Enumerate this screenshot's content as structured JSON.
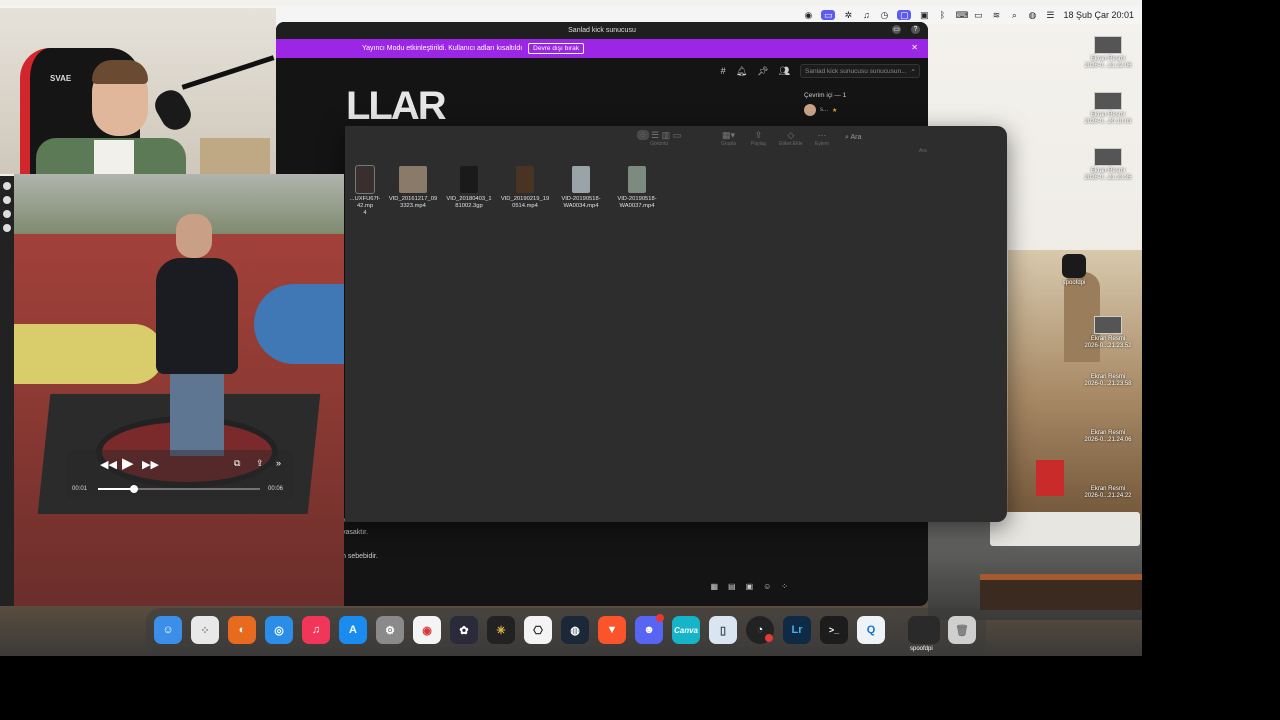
{
  "menubar": {
    "date_time": "18 Şub Çar  20:01"
  },
  "kick": {
    "window_title": "Sanlad kick sunucusu",
    "banner_text": "Yayıncı Modu etkinleştirildi. Kullanıcı adları kısaltıldı",
    "banner_button": "Devre dışı bırak",
    "search_placeholder": "Sanlad kick sunucusu sunucusun...",
    "banner_logo_text": "LLAR",
    "online_label": "Çevrim içi — 1",
    "online_user": "s...",
    "chat_lines": [
      "yasaktır.",
      "yasaktır.",
      "",
      "n sebebidir."
    ]
  },
  "finder": {
    "toolbar": {
      "view_label": "Görüntü",
      "group_label": "Grupla",
      "share_label": "Paylaş",
      "tag_label": "Etiket Ekle",
      "action_label": "Eylem",
      "search_placeholder": "Ara",
      "search_label": "Ara"
    },
    "files": [
      {
        "name": "...UXFU67f-42.mp4",
        "display": "...UXFU67f-42.mp\n4"
      },
      {
        "name": "VID_20161217_093323.mp4",
        "display": "VID_20161217_09\n3323.mp4"
      },
      {
        "name": "VID_20180403_181002.3gp",
        "display": "VID_20180403_1\n81002.3gp"
      },
      {
        "name": "VID_20190219_190514.mp4",
        "display": "VID_20190219_19\n0514.mp4"
      },
      {
        "name": "VID-20190518-WA0034.mp4",
        "display": "VID-20190518-\nWA0034.mp4"
      },
      {
        "name": "VID-20190518-WA0037.mp4",
        "display": "VID-20190518-\nWA0037.mp4"
      }
    ]
  },
  "player": {
    "current_time": "00:01",
    "duration": "00:06",
    "progress": 0.22
  },
  "webcam": {
    "chair_logo": "SVAE"
  },
  "desktop_items": [
    {
      "label1": "Ekran Resmi",
      "label2": "2026-0...21.22.06"
    },
    {
      "label1": "Ekran Resmi",
      "label2": "2026-0...20.10.03"
    },
    {
      "label1": "Ekran Resmi",
      "label2": "2026-0...21.23.35"
    },
    {
      "label1": "spoofdpi",
      "label2": ""
    },
    {
      "label1": "Ekran Resmi",
      "label2": "2026-0...21.23.52"
    },
    {
      "label1": "Ekran Resmi",
      "label2": "2026-0...21.23.58"
    },
    {
      "label1": "Ekran Resmi",
      "label2": "2026-0...21.24.06"
    },
    {
      "label1": "Ekran Resmi",
      "label2": "2026-0...21.24.22"
    }
  ],
  "dock": {
    "items": [
      "finder-app",
      "launchpad-app",
      "firefox-app",
      "safari-app",
      "music-app",
      "app-store-app",
      "system-settings-app",
      "chrome-app",
      "davinci-resolve-app",
      "perplexity-app",
      "chatgpt-app",
      "steam-app",
      "brave-app",
      "discord-app",
      "canva-app",
      "preview-app",
      "obs-app",
      "lightroom-app",
      "terminal-app",
      "quicktime-app",
      "spoofdpi-app",
      "trash"
    ],
    "spoofdpi_label": "spoofdpi",
    "canva_label": "Canva",
    "lightroom_label": "Lr",
    "terminal_label": ">_"
  }
}
